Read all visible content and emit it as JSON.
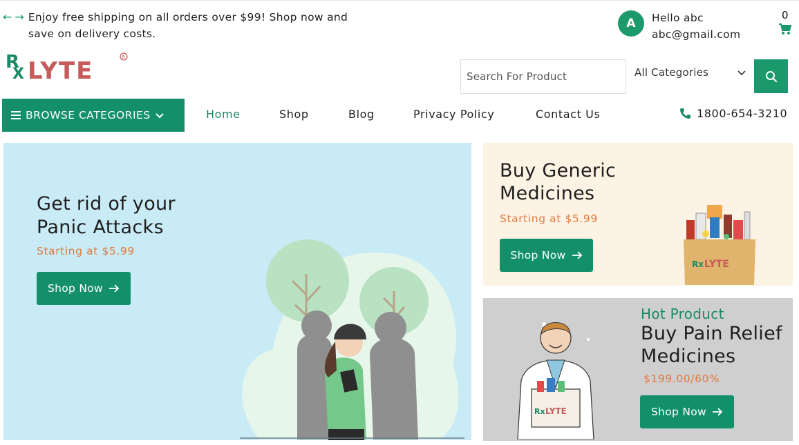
{
  "topbar": {
    "promo_text": "Enjoy free shipping on all orders over $99! Shop now and save on delivery costs.",
    "user": {
      "avatar_initial": "A",
      "greeting": "Hello abc",
      "email": "abc@gmail.com"
    },
    "cart_count": "0"
  },
  "logo": {
    "text": "RxLYTE",
    "registered_mark": "R"
  },
  "search": {
    "placeholder": "Search For Product",
    "category": "All Categories"
  },
  "nav": {
    "browse_label": "BROWSE CATEGORIES",
    "links": [
      "Home",
      "Shop",
      "Blog",
      "Privacy Policy",
      "Contact Us"
    ],
    "phone": "1800-654-3210"
  },
  "hero": {
    "title": "Get rid of your Panic Attacks",
    "subtitle": "Starting at $5.99",
    "button": "Shop Now"
  },
  "card_generic": {
    "title": "Buy Generic Medicines",
    "subtitle": "Starting at $5.99",
    "button": "Shop Now"
  },
  "card_pain": {
    "tag": "Hot Product",
    "title": "Buy Pain Relief Medicines",
    "subtitle": "$199.00/60%",
    "button": "Shop Now"
  },
  "colors": {
    "primary": "#13906a",
    "accent_orange": "#e07a3f",
    "logo_red": "#c75a5a",
    "hero_bg": "#c9ebf5",
    "card1_bg": "#fdf3e4",
    "card2_bg": "#cfcfcf"
  },
  "icons": [
    "arrow-left-icon",
    "arrow-right-icon",
    "cart-icon",
    "search-icon",
    "menu-icon",
    "chevron-down-icon",
    "phone-icon"
  ]
}
